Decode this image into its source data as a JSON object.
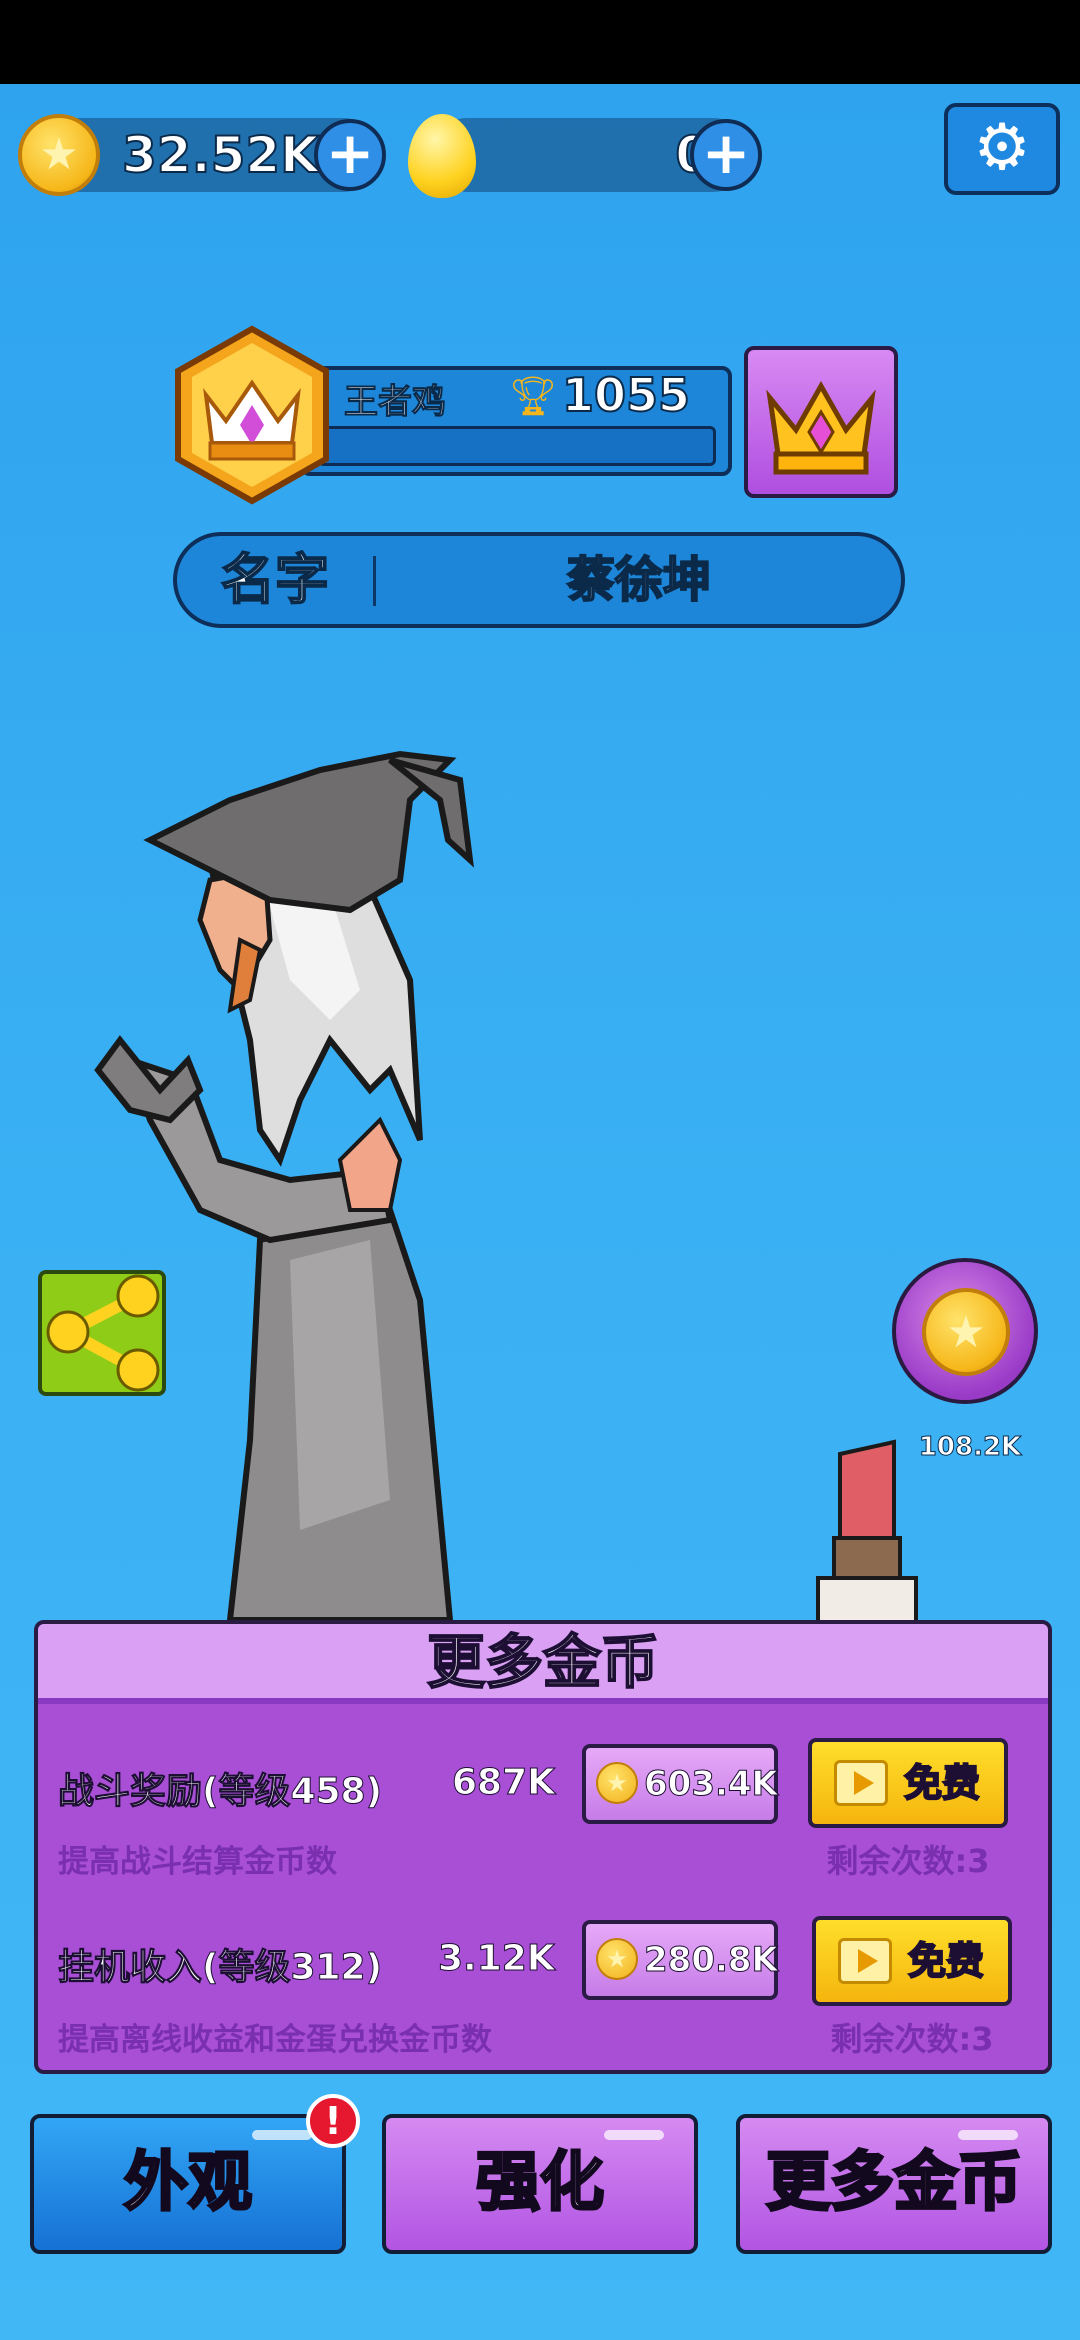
{
  "currency": {
    "coins_value": "32.52K",
    "eggs_value": "0"
  },
  "rank": {
    "title": "王者鸡",
    "trophy_score": "1055",
    "progress": 0.0
  },
  "name_field": {
    "label": "名字",
    "value": "蔡徐坤"
  },
  "coin_bubble": {
    "value": "108.2K"
  },
  "panel": {
    "title": "更多金币",
    "rows": [
      {
        "title": "战斗奖励(等级458)",
        "value": "687K",
        "description": "提高战斗结算金币数",
        "cost": "603.4K",
        "free_label": "免费",
        "remaining": "剩余次数:3"
      },
      {
        "title": "挂机收入(等级312)",
        "value": "3.12K",
        "description": "提高离线收益和金蛋兑换金币数",
        "cost": "280.8K",
        "free_label": "免费",
        "remaining": "剩余次数:3"
      }
    ]
  },
  "tabs": [
    {
      "label": "外观",
      "has_alert": true
    },
    {
      "label": "强化"
    },
    {
      "label": "更多金币"
    }
  ],
  "alert_badge": "!",
  "icons": [
    "star-coin-icon",
    "plus-icon",
    "golden-egg-icon",
    "gear-icon",
    "crown-icon",
    "trophy-icon",
    "share-icon",
    "play-video-icon"
  ],
  "colors": {
    "background": "#2ea2ee",
    "panel": "#a84fd6",
    "free_button": "#f5b50d",
    "share_button": "#8fcc17"
  }
}
